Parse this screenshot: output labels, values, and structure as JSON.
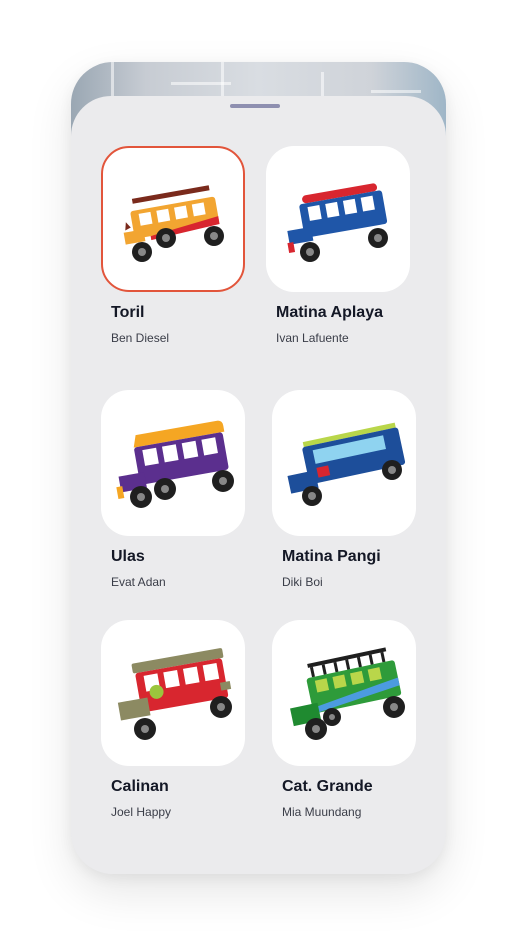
{
  "routes": [
    {
      "name": "Toril",
      "driver": "Ben Diesel",
      "selected": true,
      "icon": "jeepney-orange-red-icon"
    },
    {
      "name": "Matina Aplaya",
      "driver": "Ivan Lafuente",
      "selected": false,
      "icon": "jeepney-blue-red-icon"
    },
    {
      "name": "Ulas",
      "driver": "Evat Adan",
      "selected": false,
      "icon": "jeepney-yellow-purple-icon"
    },
    {
      "name": "Matina Pangi",
      "driver": "Diki Boi",
      "selected": false,
      "icon": "jeepney-blue-lightblue-icon"
    },
    {
      "name": "Calinan",
      "driver": "Joel Happy",
      "selected": false,
      "icon": "jeepney-olive-red-icon"
    },
    {
      "name": "Cat. Grande",
      "driver": "Mia Muundang",
      "selected": false,
      "icon": "jeepney-green-icon"
    }
  ],
  "colors": {
    "selected_border": "#e2553b",
    "sheet_bg": "#ebebed",
    "handle": "#8e8fb0"
  }
}
